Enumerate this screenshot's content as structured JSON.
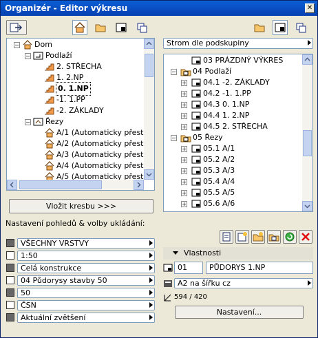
{
  "window": {
    "title": "Organizér - Editor výkresu"
  },
  "left": {
    "tree": [
      {
        "text": "Dom",
        "level": 0,
        "toggle": "minus",
        "icon": "house"
      },
      {
        "text": "Podlaží",
        "level": 1,
        "toggle": "minus",
        "icon": "floors"
      },
      {
        "text": "2. STŘECHA",
        "level": 2,
        "icon": "floor"
      },
      {
        "text": "1. 2.NP",
        "level": 2,
        "icon": "floor"
      },
      {
        "text": "0. 1.NP",
        "level": 2,
        "icon": "floor",
        "bold": true
      },
      {
        "text": "-1. 1.PP",
        "level": 2,
        "icon": "floor"
      },
      {
        "text": "-2. ZÁKLADY",
        "level": 2,
        "icon": "floor"
      },
      {
        "text": "Řezy",
        "level": 1,
        "toggle": "minus",
        "icon": "section"
      },
      {
        "text": "A/1 (Automaticky přesta",
        "level": 2,
        "icon": "house"
      },
      {
        "text": "A/2 (Automaticky přesta",
        "level": 2,
        "icon": "house"
      },
      {
        "text": "A/3 (Automaticky přesta",
        "level": 2,
        "icon": "house"
      },
      {
        "text": "A/4 (Automaticky přesta",
        "level": 2,
        "icon": "house"
      },
      {
        "text": "A/5 (Automaticky přesta",
        "level": 2,
        "icon": "house"
      }
    ],
    "place_button": "Vložit kresbu >>>",
    "settings_label": "Nastavení pohledů & volby ukládání:",
    "settings": [
      {
        "icon": "layers-icon",
        "value": "VŠECHNY VRSTVY"
      },
      {
        "icon": "scale-icon",
        "value": "1:50"
      },
      {
        "icon": "structure-icon",
        "value": "Celá konstrukce"
      },
      {
        "icon": "pen-icon",
        "value": "04 Půdorysy stavby 50"
      },
      {
        "icon": "model-icon",
        "value": "50"
      },
      {
        "icon": "dimension-icon",
        "value": "ČSN"
      },
      {
        "icon": "zoom-icon",
        "value": "Aktuální zvětšení"
      }
    ]
  },
  "right": {
    "group_select": "Strom dle podskupiny",
    "tree": [
      {
        "text": "03 PRÁZDNÝ VÝKRES",
        "level": 1,
        "icon": "sheet"
      },
      {
        "text": "04 Podlaží",
        "level": 0,
        "toggle": "minus",
        "icon": "folder"
      },
      {
        "text": "04.1 -2. ZÁKLADY",
        "level": 1,
        "toggle": "plus",
        "icon": "sheet"
      },
      {
        "text": "04.2 -1. 1.PP",
        "level": 1,
        "toggle": "plus",
        "icon": "sheet"
      },
      {
        "text": "04.3 0. 1.NP",
        "level": 1,
        "toggle": "plus",
        "icon": "sheet"
      },
      {
        "text": "04.4 1. 2.NP",
        "level": 1,
        "toggle": "plus",
        "icon": "sheet"
      },
      {
        "text": "04.5 2. STŘECHA",
        "level": 1,
        "toggle": "plus",
        "icon": "sheet"
      },
      {
        "text": "05 Řezy",
        "level": 0,
        "toggle": "minus",
        "icon": "folder"
      },
      {
        "text": "05.1 A/1",
        "level": 1,
        "toggle": "plus",
        "icon": "sheet"
      },
      {
        "text": "05.2 A/2",
        "level": 1,
        "toggle": "plus",
        "icon": "sheet"
      },
      {
        "text": "05.3 A/3",
        "level": 1,
        "toggle": "plus",
        "icon": "sheet"
      },
      {
        "text": "05.4 A/4",
        "level": 1,
        "toggle": "plus",
        "icon": "sheet"
      },
      {
        "text": "05.5 A/5",
        "level": 1,
        "toggle": "plus",
        "icon": "sheet"
      },
      {
        "text": "05.6 A/6",
        "level": 1,
        "toggle": "plus",
        "icon": "sheet"
      }
    ],
    "properties_label": "Vlastnosti",
    "sheet_id": "01",
    "sheet_name": "PŮDORYS 1.NP",
    "sheet_format": "A2 na šířku cz",
    "size": "594 / 420",
    "settings_button": "Nastavení..."
  }
}
